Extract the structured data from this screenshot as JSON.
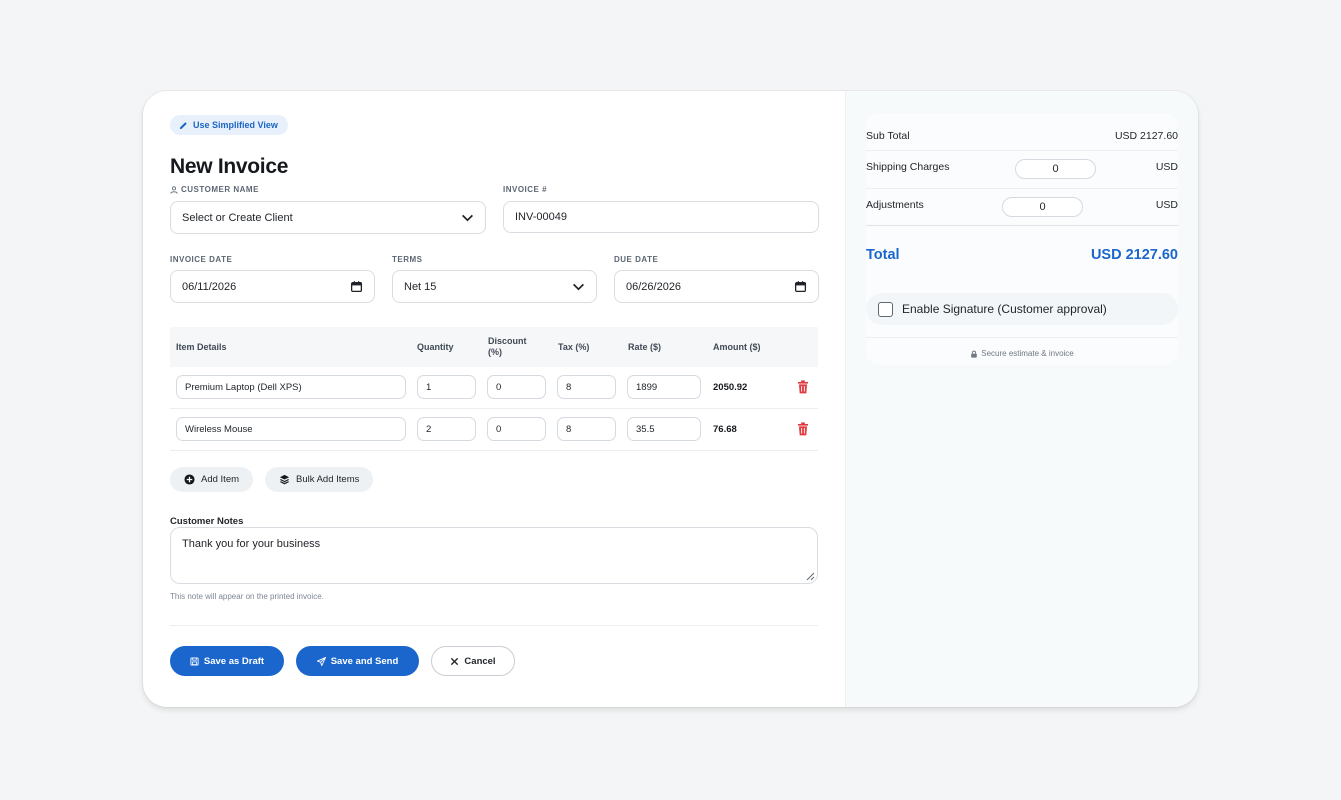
{
  "header": {
    "simplified_view": "Use Simplified View",
    "title": "New Invoice"
  },
  "form": {
    "customer_label": "CUSTOMER NAME",
    "customer_value": "Select or Create Client",
    "invoice_num_label": "INVOICE #",
    "invoice_num_value": "INV-00049",
    "invoice_date_label": "INVOICE DATE",
    "invoice_date_value": "06/11/2026",
    "terms_label": "TERMS",
    "terms_value": "Net 15",
    "due_date_label": "DUE DATE",
    "due_date_value": "06/26/2026"
  },
  "table": {
    "headers": {
      "item": "Item Details",
      "quantity": "Quantity",
      "discount_1": "Discount",
      "discount_2": "(%)",
      "tax": "Tax (%)",
      "rate": "Rate ($)",
      "amount": "Amount ($)"
    },
    "rows": [
      {
        "item": "Premium Laptop (Dell XPS)",
        "quantity": "1",
        "discount": "0",
        "tax": "8",
        "rate": "1899",
        "amount": "2050.92"
      },
      {
        "item": "Wireless Mouse",
        "quantity": "2",
        "discount": "0",
        "tax": "8",
        "rate": "35.5",
        "amount": "76.68"
      }
    ]
  },
  "actions": {
    "add_item": "Add Item",
    "bulk_add": "Bulk Add Items",
    "save_draft": "Save as Draft",
    "save_send": "Save and Send",
    "cancel": "Cancel"
  },
  "notes": {
    "label": "Customer Notes",
    "value": "Thank you for your business",
    "hint": "This note will appear on the printed invoice."
  },
  "summary": {
    "subtotal_label": "Sub Total",
    "subtotal_value": "USD 2127.60",
    "shipping_label": "Shipping Charges",
    "shipping_value": "0",
    "shipping_currency": "USD",
    "adjustments_label": "Adjustments",
    "adjustments_value": "0",
    "adjustments_currency": "USD",
    "total_label": "Total",
    "total_value": "USD 2127.60",
    "signature_label": "Enable Signature (Customer approval)",
    "secure_text": "Secure estimate & invoice"
  },
  "colors": {
    "accent": "#1a66cc",
    "danger": "#e0393e",
    "badge_bg": "#e8f1fb"
  }
}
